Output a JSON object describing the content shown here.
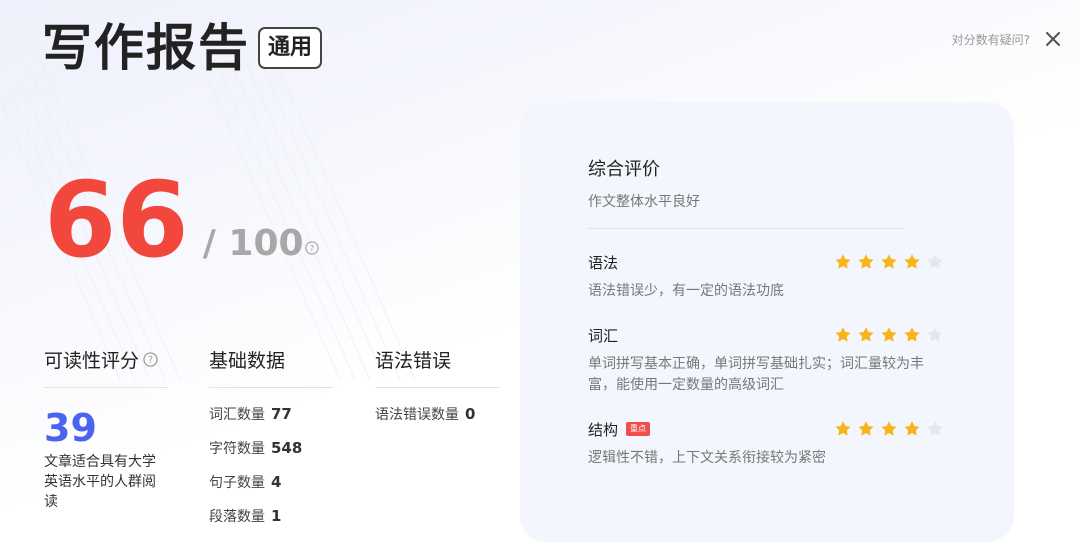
{
  "header": {
    "title": "写作报告",
    "badge": "通用",
    "doubt_link": "对分数有疑问?"
  },
  "score": {
    "value": "66",
    "total": "/ 100"
  },
  "readability": {
    "label": "可读性评分",
    "score": "39",
    "desc": "文章适合具有大学英语水平的人群阅读"
  },
  "basic": {
    "label": "基础数据",
    "items": [
      {
        "label": "词汇数量",
        "value": "77"
      },
      {
        "label": "字符数量",
        "value": "548"
      },
      {
        "label": "句子数量",
        "value": "4"
      },
      {
        "label": "段落数量",
        "value": "1"
      }
    ]
  },
  "grammar_errors": {
    "label": "语法错误",
    "items": [
      {
        "label": "语法错误数量",
        "value": "0"
      }
    ]
  },
  "evaluation": {
    "title": "综合评价",
    "subtitle": "作文整体水平良好",
    "criteria": [
      {
        "name": "语法",
        "rating": 4,
        "max": 5,
        "desc": "语法错误少，有一定的语法功底",
        "tag": ""
      },
      {
        "name": "词汇",
        "rating": 4,
        "max": 5,
        "desc": "单词拼写基本正确，单词拼写基础扎实；词汇量较为丰富，能使用一定数量的高级词汇",
        "tag": ""
      },
      {
        "name": "结构",
        "rating": 4,
        "max": 5,
        "desc": "逻辑性不错，上下文关系衔接较为紧密",
        "tag": "重点"
      }
    ]
  },
  "colors": {
    "score": "#f2473c",
    "readability": "#4a63f0",
    "star_on": "#f7b51b",
    "star_off": "#e6e7ec",
    "tag": "#f24d4d",
    "panel_bg": "#f4f6fd"
  },
  "icons": {
    "close": "close-icon",
    "help": "question-circle-icon",
    "star": "star-icon"
  }
}
